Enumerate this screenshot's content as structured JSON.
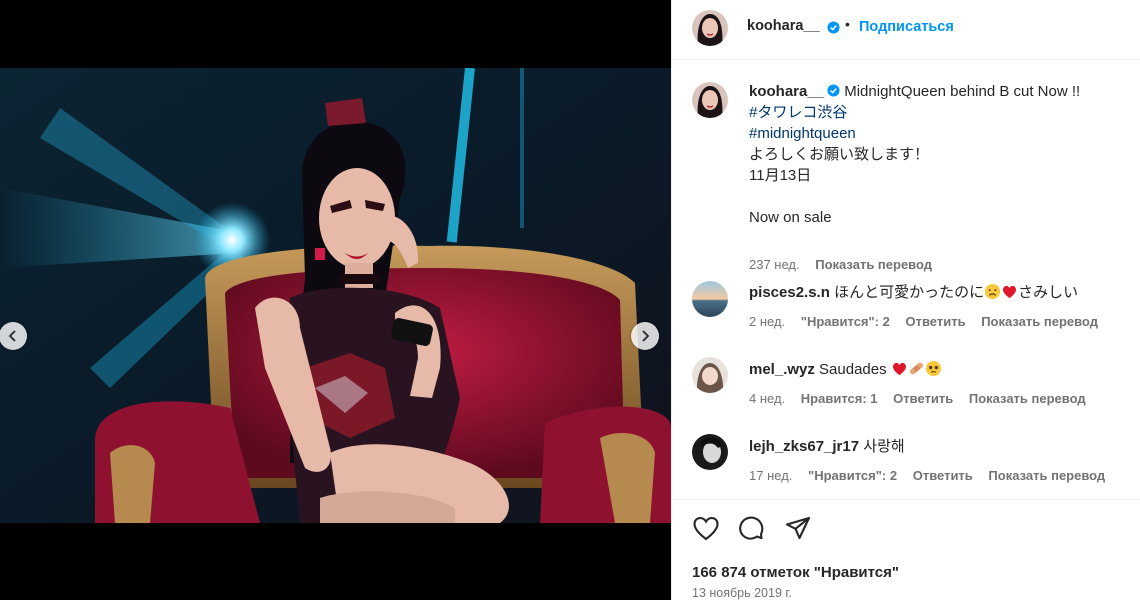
{
  "header": {
    "username": "koohara__",
    "separator": "•",
    "follow_label": "Подписаться"
  },
  "caption": {
    "username": "koohara__",
    "text": "MidnightQueen behind B cut Now !!",
    "hashtag1": "#タワレコ渋谷",
    "hashtag2": "#midnightqueen",
    "line3": "よろしくお願い致します！",
    "line4": "11月13日",
    "line5": "Now on sale",
    "time": "237 нед.",
    "translate": "Показать перевод"
  },
  "comments": [
    {
      "username": "pisces2.s.n",
      "text_a": "ほんと可愛かったのに",
      "text_b": "さみしい",
      "time": "2 нед.",
      "likes": "\"Нравится\": 2",
      "reply": "Ответить",
      "translate": "Показать перевод"
    },
    {
      "username": "mel_.wyz",
      "text_a": "Saudades",
      "time": "4 нед.",
      "likes": "Нравится: 1",
      "reply": "Ответить",
      "translate": "Показать перевод"
    },
    {
      "username": "lejh_zks67_jr17",
      "text_a": "사랑해",
      "time": "17 нед.",
      "likes": "\"Нравится\": 2",
      "reply": "Ответить",
      "translate": "Показать перевод"
    }
  ],
  "footer": {
    "likes": "166 874 отметок \"Нравится\"",
    "date": "13 ноябрь 2019 г."
  },
  "icons": {
    "like": "heart-outline-icon",
    "comment": "speech-bubble-icon",
    "share": "paper-plane-icon",
    "prev": "chevron-left-icon",
    "next": "chevron-right-icon",
    "verified": "verified-badge-icon"
  },
  "colors": {
    "accent": "#0095f6",
    "hashtag": "#00376b",
    "muted": "#737373",
    "text": "#262626",
    "verified": "#0095f6"
  }
}
